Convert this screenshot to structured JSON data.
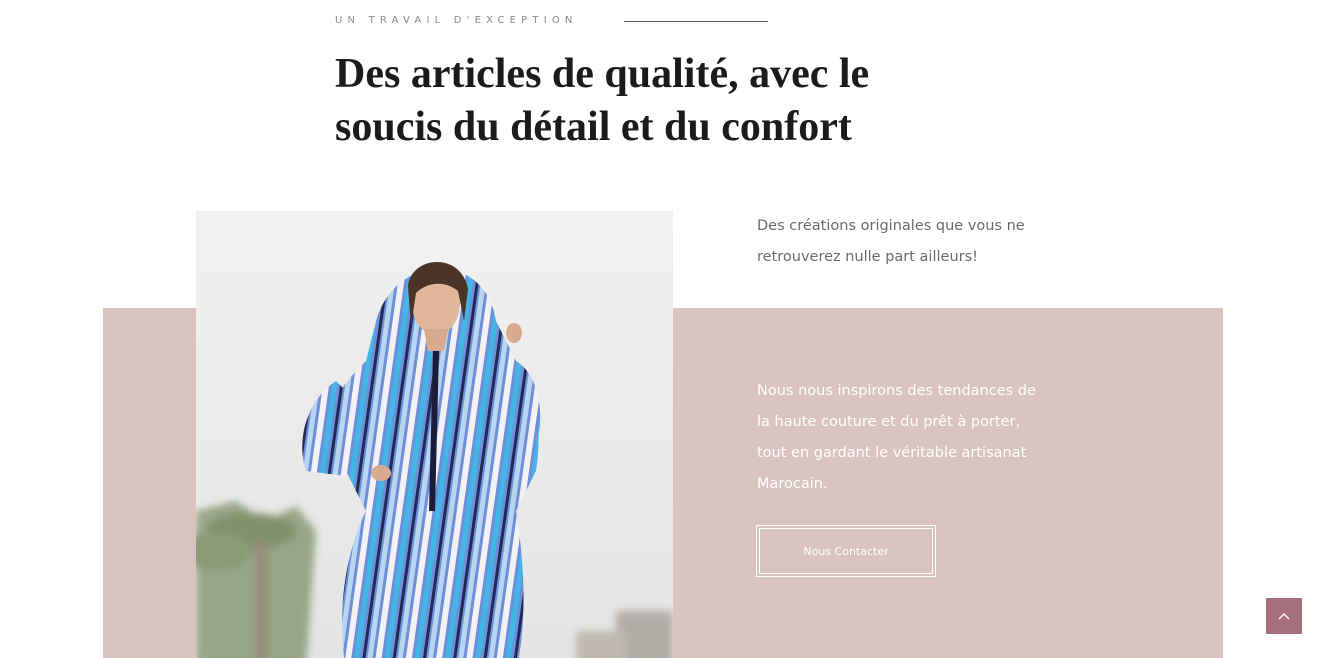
{
  "section": {
    "eyebrow": "UN TRAVAIL D'EXCEPTION",
    "heading": "Des articles de qualité, avec le soucis du détail et du confort",
    "intro": "Des créations originales que vous ne retrouverez nulle part ailleurs!",
    "description": "Nous nous inspirons des tendances de la haute couture et du prêt à porter, tout en gardant le véritable artisanat Marocain.",
    "button_label": "Nous Contacter"
  },
  "colors": {
    "panel": "#d8c3bf",
    "back_to_top": "#a8707c",
    "heading": "#1b1b1b"
  },
  "icons": {
    "back_to_top": "chevron-up-icon"
  }
}
